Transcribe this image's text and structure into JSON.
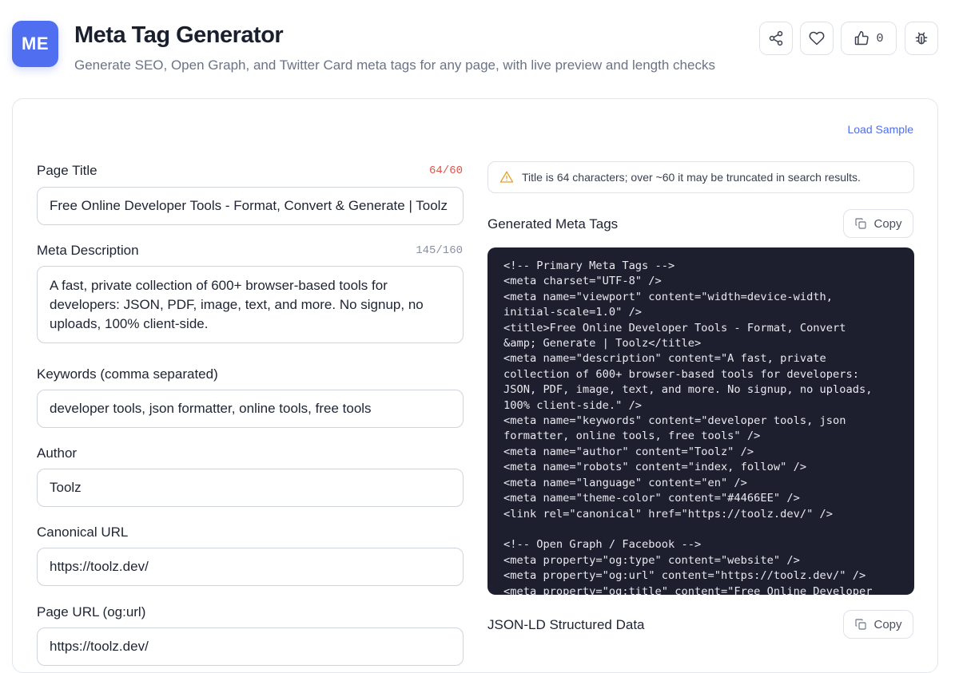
{
  "header": {
    "logo_text": "ME",
    "title": "Meta Tag Generator",
    "subtitle": "Generate SEO, Open Graph, and Twitter Card meta tags for any page, with live preview and length checks",
    "like_count": "0"
  },
  "toolbar": {
    "load_sample": "Load Sample"
  },
  "form": {
    "page_title": {
      "label": "Page Title",
      "count": "64/60",
      "value": "Free Online Developer Tools - Format, Convert & Generate | Toolz"
    },
    "meta_description": {
      "label": "Meta Description",
      "count": "145/160",
      "value": "A fast, private collection of 600+ browser-based tools for developers: JSON, PDF, image, text, and more. No signup, no uploads, 100% client-side."
    },
    "keywords": {
      "label": "Keywords (comma separated)",
      "value": "developer tools, json formatter, online tools, free tools"
    },
    "author": {
      "label": "Author",
      "value": "Toolz"
    },
    "canonical": {
      "label": "Canonical URL",
      "value": "https://toolz.dev/"
    },
    "page_url": {
      "label": "Page URL (og:url)",
      "value": "https://toolz.dev/"
    }
  },
  "warning": {
    "text": "Title is 64 characters; over ~60 it may be truncated in search results.",
    "color": "#e4a32c"
  },
  "output": {
    "generated_title": "Generated Meta Tags",
    "jsonld_title": "JSON-LD Structured Data",
    "copy_label": "Copy",
    "code": "<!-- Primary Meta Tags -->\n<meta charset=\"UTF-8\" />\n<meta name=\"viewport\" content=\"width=device-width,\ninitial-scale=1.0\" />\n<title>Free Online Developer Tools - Format, Convert\n&amp; Generate | Toolz</title>\n<meta name=\"description\" content=\"A fast, private\ncollection of 600+ browser-based tools for developers:\nJSON, PDF, image, text, and more. No signup, no uploads,\n100% client-side.\" />\n<meta name=\"keywords\" content=\"developer tools, json\nformatter, online tools, free tools\" />\n<meta name=\"author\" content=\"Toolz\" />\n<meta name=\"robots\" content=\"index, follow\" />\n<meta name=\"language\" content=\"en\" />\n<meta name=\"theme-color\" content=\"#4466EE\" />\n<link rel=\"canonical\" href=\"https://toolz.dev/\" />\n\n<!-- Open Graph / Facebook -->\n<meta property=\"og:type\" content=\"website\" />\n<meta property=\"og:url\" content=\"https://toolz.dev/\" />\n<meta property=\"og:title\" content=\"Free Online Developer"
  },
  "colors": {
    "accent": "#4f6ef0",
    "over_limit": "#e0524a",
    "code_bg": "#1e1f2e"
  },
  "icons": [
    "share-icon",
    "heart-icon",
    "thumbs-up-icon",
    "bug-icon",
    "warning-icon",
    "copy-icon"
  ]
}
